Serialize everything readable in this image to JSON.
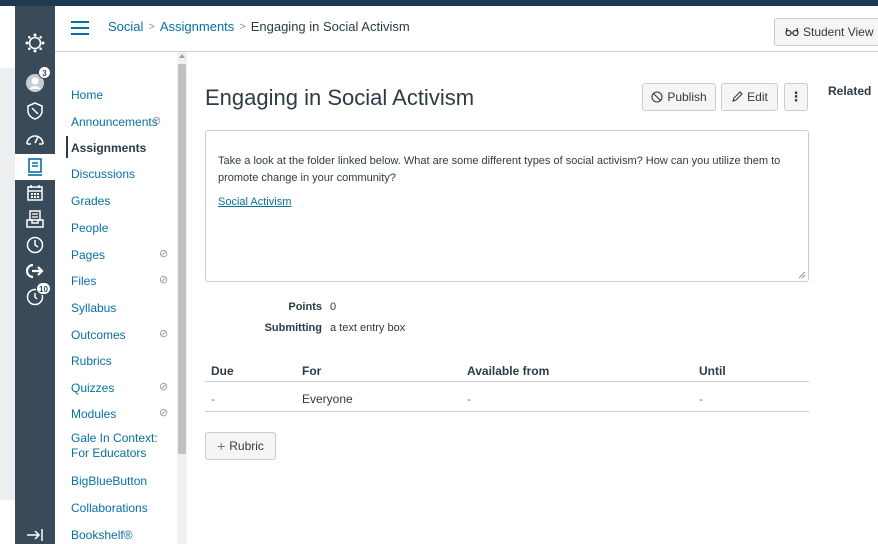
{
  "header": {
    "breadcrumb": [
      "Social",
      "Assignments",
      "Engaging in Social Activism"
    ],
    "student_view_label": "Student View"
  },
  "global_nav": {
    "account_badge": "3",
    "history_badge": "10"
  },
  "course_nav": {
    "items": [
      {
        "label": "Home",
        "hidden": false
      },
      {
        "label": "Announcements",
        "hidden": true
      },
      {
        "label": "Assignments",
        "hidden": false,
        "active": true
      },
      {
        "label": "Discussions",
        "hidden": false
      },
      {
        "label": "Grades",
        "hidden": false
      },
      {
        "label": "People",
        "hidden": false
      },
      {
        "label": "Pages",
        "hidden": true
      },
      {
        "label": "Files",
        "hidden": true
      },
      {
        "label": "Syllabus",
        "hidden": false
      },
      {
        "label": "Outcomes",
        "hidden": true
      },
      {
        "label": "Rubrics",
        "hidden": false
      },
      {
        "label": "Quizzes",
        "hidden": true
      },
      {
        "label": "Modules",
        "hidden": true
      },
      {
        "label": "Gale In Context: For Educators",
        "hidden": false
      },
      {
        "label": "BigBlueButton",
        "hidden": false
      },
      {
        "label": "Collaborations",
        "hidden": false
      },
      {
        "label": "Bookshelf®",
        "hidden": false
      }
    ]
  },
  "assignment": {
    "title": "Engaging in Social Activism",
    "publish_label": "Publish",
    "edit_label": "Edit",
    "description": "Take a look at the folder linked below. What are some different types of social activism? How can you utilize them to promote change in your community?",
    "link_text": "Social Activism",
    "points_label": "Points",
    "points_value": "0",
    "submitting_label": "Submitting",
    "submitting_value": "a text entry box",
    "dates_table": {
      "headers": [
        "Due",
        "For",
        "Available from",
        "Until"
      ],
      "rows": [
        [
          "-",
          "Everyone",
          "-",
          "-"
        ]
      ]
    },
    "rubric_label": "Rubric"
  },
  "sidebar_right": {
    "related_label": "Related"
  },
  "colors": {
    "link": "#0770a3",
    "nav_bg": "#394b58",
    "text": "#2d3b45"
  }
}
